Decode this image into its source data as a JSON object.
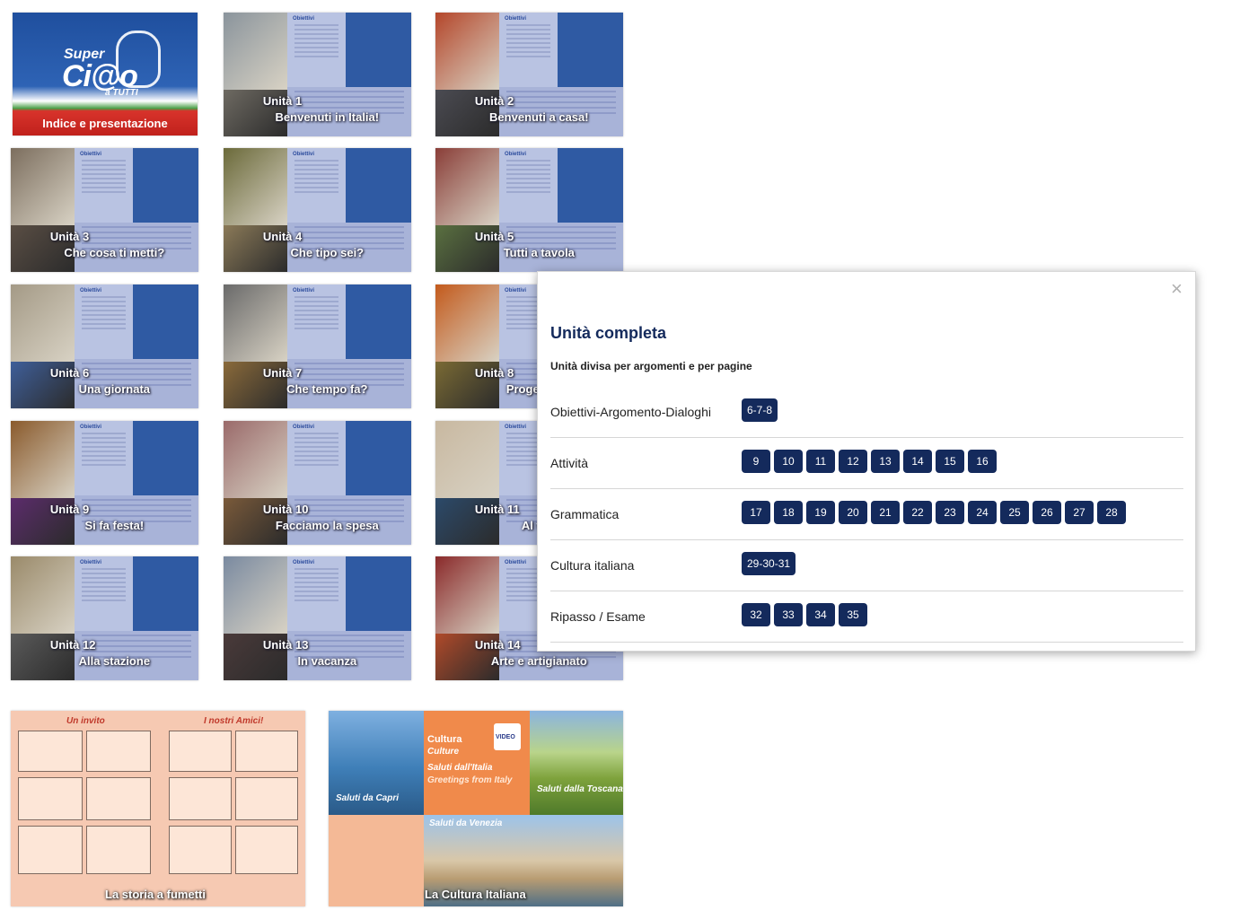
{
  "cover": {
    "label": "Indice e presentazione",
    "logo": {
      "line1": "Super",
      "line2": "Ci@o",
      "line3": "a TUTTI"
    }
  },
  "units": [
    {
      "unit": "Unità 1",
      "title": "Benvenuti in Italia!"
    },
    {
      "unit": "Unità 2",
      "title": "Benvenuti a casa!"
    },
    {
      "unit": "Unità 3",
      "title": "Che cosa ti metti?"
    },
    {
      "unit": "Unità 4",
      "title": "Che tipo sei?"
    },
    {
      "unit": "Unità 5",
      "title": "Tutti a tavola"
    },
    {
      "unit": "Unità 6",
      "title": "Una giornata"
    },
    {
      "unit": "Unità 7",
      "title": "Che tempo fa?"
    },
    {
      "unit": "Unità 8",
      "title": "Progetti per"
    },
    {
      "unit": "Unità 9",
      "title": "Si fa festa!"
    },
    {
      "unit": "Unità 10",
      "title": "Facciamo la spesa"
    },
    {
      "unit": "Unità 11",
      "title": "Al tele"
    },
    {
      "unit": "Unità 12",
      "title": "Alla stazione"
    },
    {
      "unit": "Unità 13",
      "title": "In vacanza"
    },
    {
      "unit": "Unità 14",
      "title": "Arte e artigianato"
    }
  ],
  "obiettivi_label": "Obiettivi",
  "argomento_label": "Argomento",
  "comic": {
    "header_left": "Un invito",
    "header_right": "I nostri Amici!",
    "caption": "La storia a fumetti"
  },
  "culture": {
    "tag1": "Cultura",
    "tag2": "Culture",
    "line1": "Saluti dall'Italia",
    "line2": "Greetings from Italy",
    "capri": "Saluti da Capri",
    "toscana": "Saluti dalla Toscana",
    "venezia": "Saluti da Venezia",
    "video": "VIDEO",
    "caption": "La Cultura Italiana"
  },
  "modal": {
    "close": "×",
    "title": "Unità completa",
    "subtitle": "Unità divisa per argomenti e per pagine",
    "rows": [
      {
        "label": "Obiettivi-Argomento-Dialoghi",
        "pages": [
          "6-7-8"
        ]
      },
      {
        "label": "Attività",
        "pages": [
          "9",
          "10",
          "11",
          "12",
          "13",
          "14",
          "15",
          "16"
        ]
      },
      {
        "label": "Grammatica",
        "pages": [
          "17",
          "18",
          "19",
          "20",
          "21",
          "22",
          "23",
          "24",
          "25",
          "26",
          "27",
          "28"
        ]
      },
      {
        "label": "Cultura italiana",
        "pages": [
          "29-30-31"
        ]
      },
      {
        "label": "Ripasso / Esame",
        "pages": [
          "32",
          "33",
          "34",
          "35"
        ]
      }
    ]
  },
  "colors": {
    "accent": "#142a5c",
    "unit_blue": "#2f5aa3",
    "panel": "#b9c3e2"
  }
}
